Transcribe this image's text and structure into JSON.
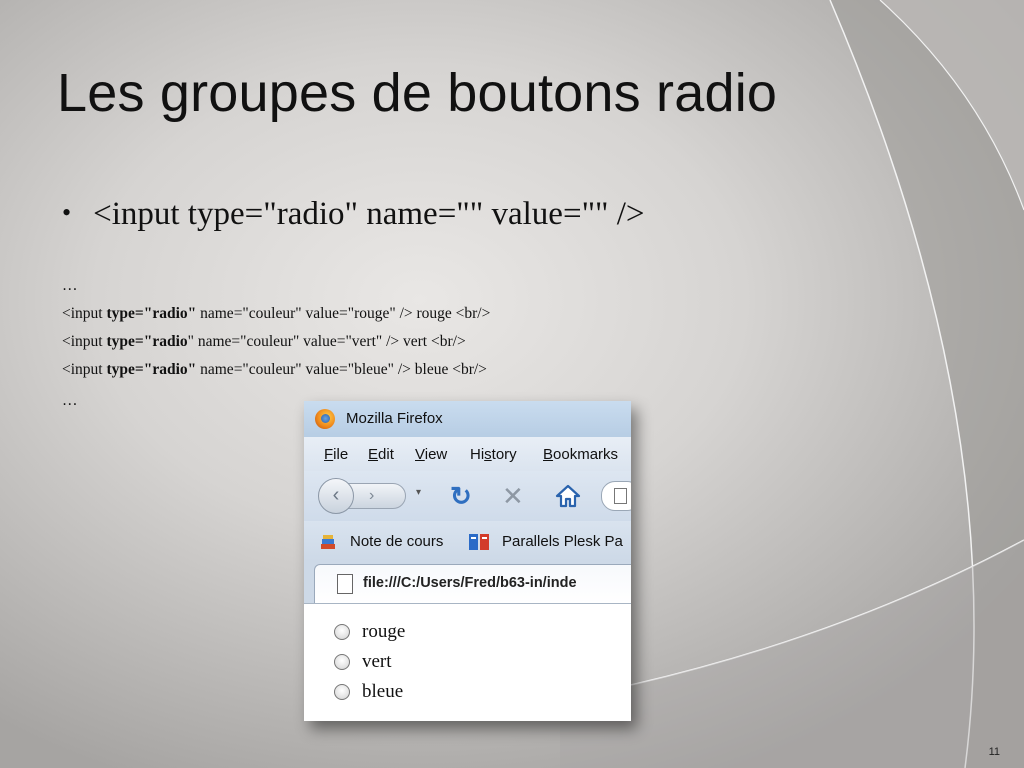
{
  "slide": {
    "title": "Les groupes de boutons radio",
    "bullet_marker": "•",
    "bullet_text": "<input type=\"radio\" name=\"\" value=\"\" />",
    "code_ellipsis_top": "…",
    "code_lines": [
      {
        "pre": "<input ",
        "bold": "type=\"radio\"",
        "post": " name=\"couleur\" value=\"rouge\" /> rouge <br/>"
      },
      {
        "pre": "<input ",
        "bold": "type=\"radio",
        "post": "\" name=\"couleur\" value=\"vert\" /> vert <br/>"
      },
      {
        "pre": "<input ",
        "bold": "type=\"radio\"",
        "post": " name=\"couleur\" value=\"bleue\" /> bleue <br/>"
      }
    ],
    "code_ellipsis_bottom": " …",
    "page_number": "11"
  },
  "browser": {
    "window_title": "Mozilla Firefox",
    "menu": {
      "file": {
        "u": "F",
        "rest": "ile"
      },
      "edit": {
        "u": "E",
        "rest": "dit"
      },
      "view": {
        "u": "V",
        "rest": "iew"
      },
      "history": {
        "pre": "Hi",
        "u": "s",
        "rest": "tory"
      },
      "bookmarks": {
        "u": "B",
        "rest": "ookmarks"
      }
    },
    "nav": {
      "back_glyph": "‹",
      "forward_glyph": "›",
      "dropdown_glyph": "▾",
      "reload_glyph": "↻",
      "stop_glyph": "✕"
    },
    "bookmarks": [
      "Note de cours",
      "Parallels Plesk Pa"
    ],
    "address": "file:///C:/Users/Fred/b63-in/inde",
    "radio_options": [
      "rouge",
      "vert",
      "bleue"
    ],
    "colors": {
      "accent": "#2f6fc0",
      "titlebar": "#c9dcef"
    }
  }
}
